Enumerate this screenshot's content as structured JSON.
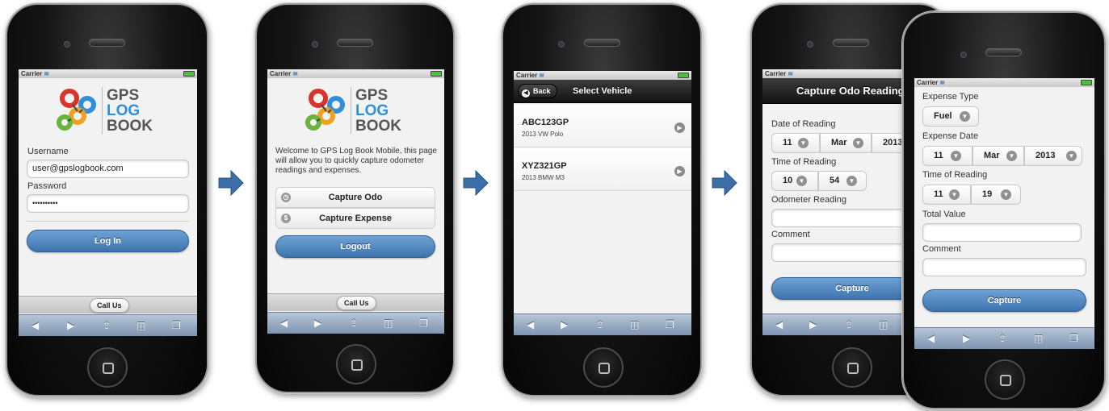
{
  "status": {
    "carrier": "Carrier"
  },
  "logo": {
    "line1": "GPS",
    "line2": "LOG",
    "line3": "BOOK"
  },
  "login": {
    "username_label": "Username",
    "username_value": "user@gpslogbook.com",
    "password_label": "Password",
    "password_value": "••••••••••",
    "login_button": "Log In",
    "call_us": "Call Us"
  },
  "home": {
    "welcome": "Welcome to GPS Log Book Mobile, this page will allow you to quickly capture odometer readings and expenses.",
    "capture_odo": "Capture Odo",
    "capture_expense": "Capture Expense",
    "logout": "Logout",
    "call_us": "Call Us"
  },
  "vehicles": {
    "back": "Back",
    "title": "Select Vehicle",
    "items": [
      {
        "plate": "ABC123GP",
        "desc": "2013 VW Polo"
      },
      {
        "plate": "XYZ321GP",
        "desc": "2013 BMW M3"
      }
    ]
  },
  "odo": {
    "title": "Capture Odo Reading",
    "date_label": "Date of Reading",
    "day": "11",
    "month": "Mar",
    "year": "2013",
    "time_label": "Time of Reading",
    "hour": "10",
    "minute": "54",
    "odometer_label": "Odometer Reading",
    "comment_label": "Comment",
    "capture": "Capture"
  },
  "expense": {
    "type_label": "Expense Type",
    "type_value": "Fuel",
    "date_label": "Expense Date",
    "day": "11",
    "month": "Mar",
    "year": "2013",
    "time_label": "Time of Reading",
    "hour": "11",
    "minute": "19",
    "total_label": "Total Value",
    "comment_label": "Comment",
    "capture": "Capture"
  },
  "toolbar": {
    "back": "◀",
    "forward": "▶",
    "share": "⇪",
    "bookmarks": "📖",
    "tabs": "❐"
  },
  "colors": {
    "accent_blue": "#3d74ad",
    "logo_blue": "#2f8fd8",
    "logo_gray": "#555555",
    "arrow_blue": "#3c6fa8"
  }
}
